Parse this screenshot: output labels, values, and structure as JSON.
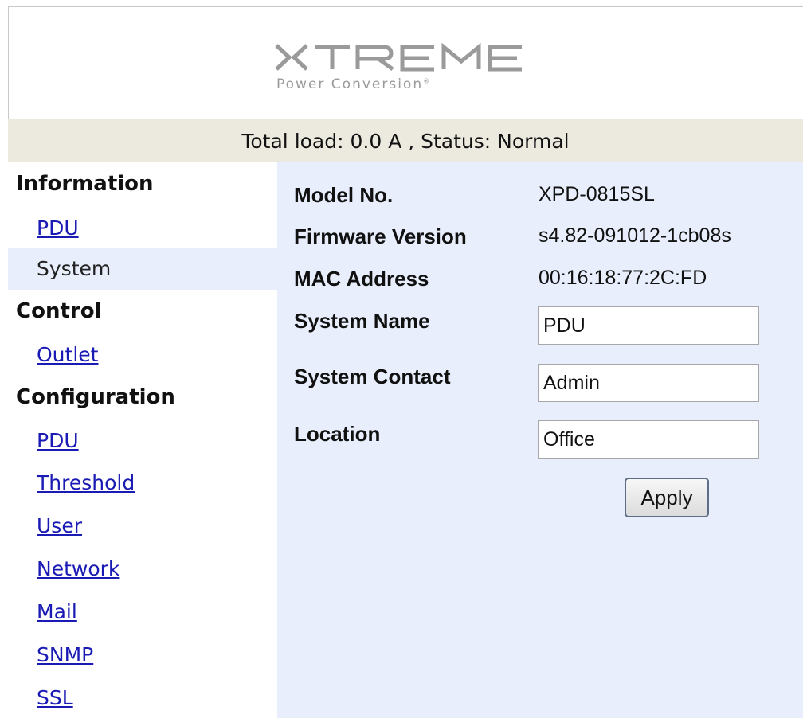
{
  "brand": {
    "logo_text": "XTREME",
    "logo_subtitle": "Power Conversion",
    "logo_mark": "®",
    "logo_color": "#9a9a9a"
  },
  "status": {
    "text": "Total load: 0.0 A , Status: Normal",
    "bar_color": "#ece9df"
  },
  "sidebar": {
    "information": {
      "heading": "Information",
      "items": [
        {
          "label": "PDU",
          "selected": false
        },
        {
          "label": "System",
          "selected": true
        }
      ]
    },
    "control": {
      "heading": "Control",
      "items": [
        {
          "label": "Outlet",
          "selected": false
        }
      ]
    },
    "configuration": {
      "heading": "Configuration",
      "items": [
        {
          "label": "PDU"
        },
        {
          "label": "Threshold"
        },
        {
          "label": "User"
        },
        {
          "label": "Network"
        },
        {
          "label": "Mail"
        },
        {
          "label": "SNMP"
        },
        {
          "label": "SSL"
        }
      ]
    },
    "link_color": "#1a1ab4",
    "selected_bg": "#e8eefb"
  },
  "system_info": {
    "model_label": "Model No.",
    "model_value": "XPD-0815SL",
    "firmware_label": "Firmware Version",
    "firmware_value": "s4.82-091012-1cb08s",
    "mac_label": "MAC Address",
    "mac_value": "00:16:18:77:2C:FD"
  },
  "form": {
    "system_name_label": "System Name",
    "system_name_value": "PDU",
    "system_contact_label": "System Contact",
    "system_contact_value": "Admin",
    "location_label": "Location",
    "location_value": "Office",
    "apply_label": "Apply",
    "panel_bg": "#e8eefb"
  }
}
